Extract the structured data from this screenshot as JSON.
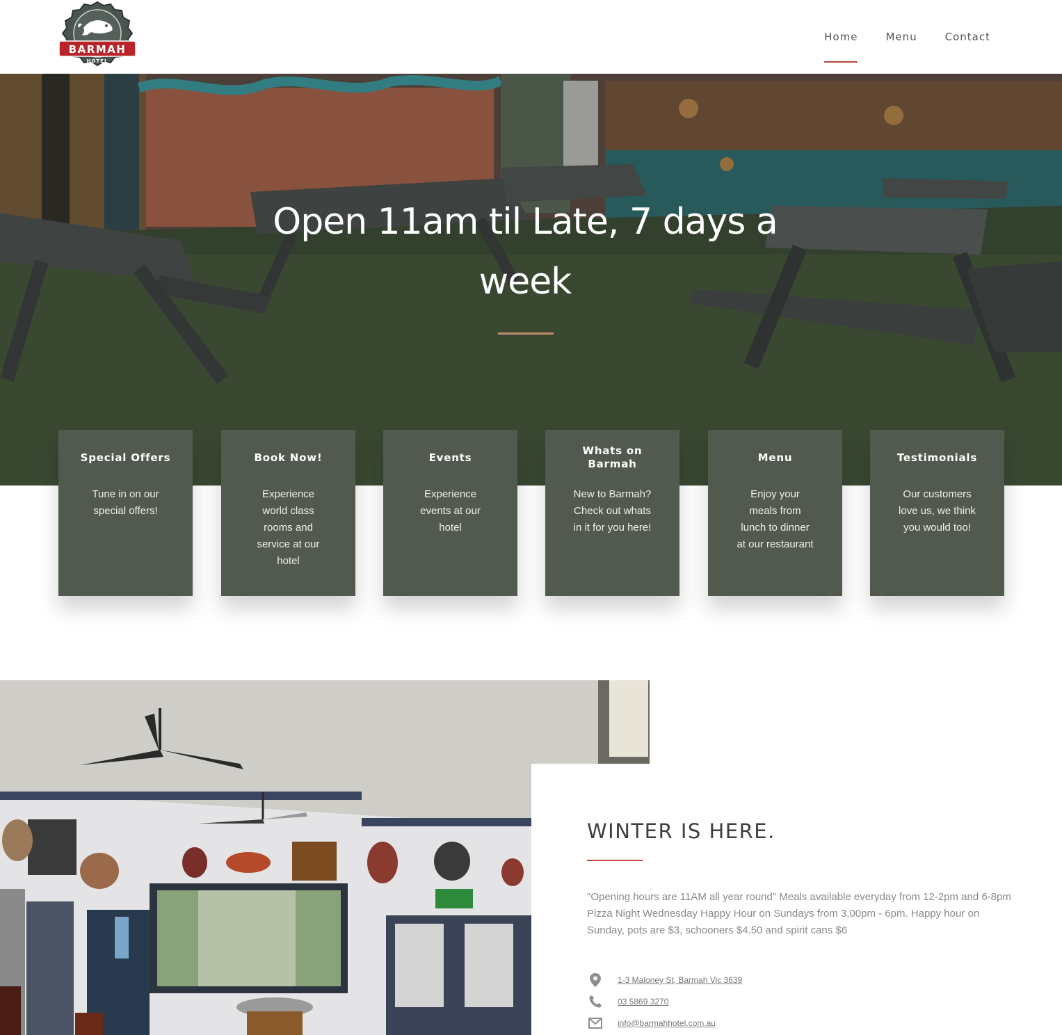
{
  "brand": {
    "name": "BARMAH",
    "subtitle": "HOTEL"
  },
  "nav": [
    {
      "label": "Home",
      "active": true
    },
    {
      "label": "Menu",
      "active": false
    },
    {
      "label": "Contact",
      "active": false
    }
  ],
  "hero": {
    "title": "Open 11am til Late, 7 days a week"
  },
  "features": [
    {
      "title": "Special Offers",
      "text": "Tune in on our special offers!"
    },
    {
      "title": "Book Now!",
      "text": "Experience world class rooms and service at our hotel"
    },
    {
      "title": "Events",
      "text": "Experience events at our hotel"
    },
    {
      "title": "Whats on Barmah",
      "text": "New to Barmah? Check out whats in it for you here!"
    },
    {
      "title": "Menu",
      "text": "Enjoy your meals from lunch to dinner at our restaurant"
    },
    {
      "title": "Testimonials",
      "text": "Our customers love us, we think you would too!"
    }
  ],
  "winter": {
    "heading": "WINTER IS HERE.",
    "description": "\"Opening hours are 11AM all year round\" Meals available everyday from 12-2pm and 6-8pm Pizza Night Wednesday Happy Hour on Sundays from 3.00pm - 6pm. Happy hour on Sunday, pots are $3, schooners $4.50 and spirit cans $6"
  },
  "contact": {
    "address": "1-3 Maloney St, Barmah Vic 3639",
    "phone": "03 5869 3270",
    "email": "info@barmahhotel.com.au"
  },
  "colors": {
    "box_bg": "#525a50",
    "accent": "#b64a3a",
    "hero_rule": "#c08a6d"
  },
  "icons": [
    "map-pin-icon",
    "phone-icon",
    "envelope-icon"
  ]
}
